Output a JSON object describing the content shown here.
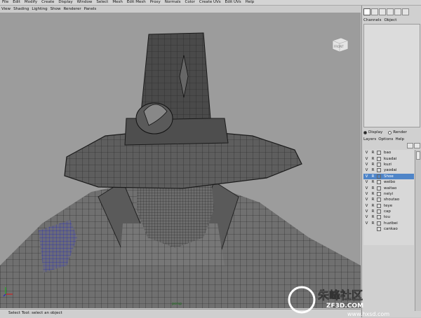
{
  "menus": [
    "File",
    "Edit",
    "Modify",
    "Create",
    "Display",
    "Window",
    "Select",
    "Mesh",
    "Edit Mesh",
    "Proxy",
    "Normals",
    "Color",
    "Create UVs",
    "Edit UVs",
    "Help"
  ],
  "panel_menus": [
    "View",
    "Shading",
    "Lighting",
    "Show",
    "Renderer",
    "Panels"
  ],
  "viewcube_label": "FRONT",
  "viewport_label": "persp",
  "status_text": "Select Tool: select an object",
  "channel_tabs": [
    "Channels",
    "Object"
  ],
  "display_radio": "Display",
  "render_radio": "Render",
  "layer_menus": [
    "Layers",
    "Options",
    "Help"
  ],
  "layers": [
    {
      "v": "V",
      "r": "R",
      "name": "bao"
    },
    {
      "v": "V",
      "r": "R",
      "name": "kuadai"
    },
    {
      "v": "V",
      "r": "R",
      "name": "kuzi"
    },
    {
      "v": "V",
      "r": "R",
      "name": "yaodai"
    },
    {
      "v": "V",
      "r": "R",
      "name": "Shoe"
    },
    {
      "v": "V",
      "r": "R",
      "name": "weibo"
    },
    {
      "v": "V",
      "r": "R",
      "name": "waitao"
    },
    {
      "v": "V",
      "r": "R",
      "name": "neiyi"
    },
    {
      "v": "V",
      "r": "R",
      "name": "shoutao"
    },
    {
      "v": "V",
      "r": "R",
      "name": "teye"
    },
    {
      "v": "V",
      "r": "R",
      "name": "cap"
    },
    {
      "v": "V",
      "r": "R",
      "name": "tou"
    },
    {
      "v": "V",
      "r": "R",
      "name": "huzibei"
    },
    {
      "v": "",
      "r": "",
      "name": "cankao"
    }
  ],
  "selected_layer": "Shoe",
  "colors": {
    "selection": "#4f85c8",
    "viewport_bg": "#9c9c9c",
    "wire": "#1a1a1a",
    "highlight": "#2a2fb0"
  },
  "watermark_line1": "朱峰社区",
  "watermark_line2": "ZF3D.COM",
  "watermark_line3": "www.hxsd.com"
}
